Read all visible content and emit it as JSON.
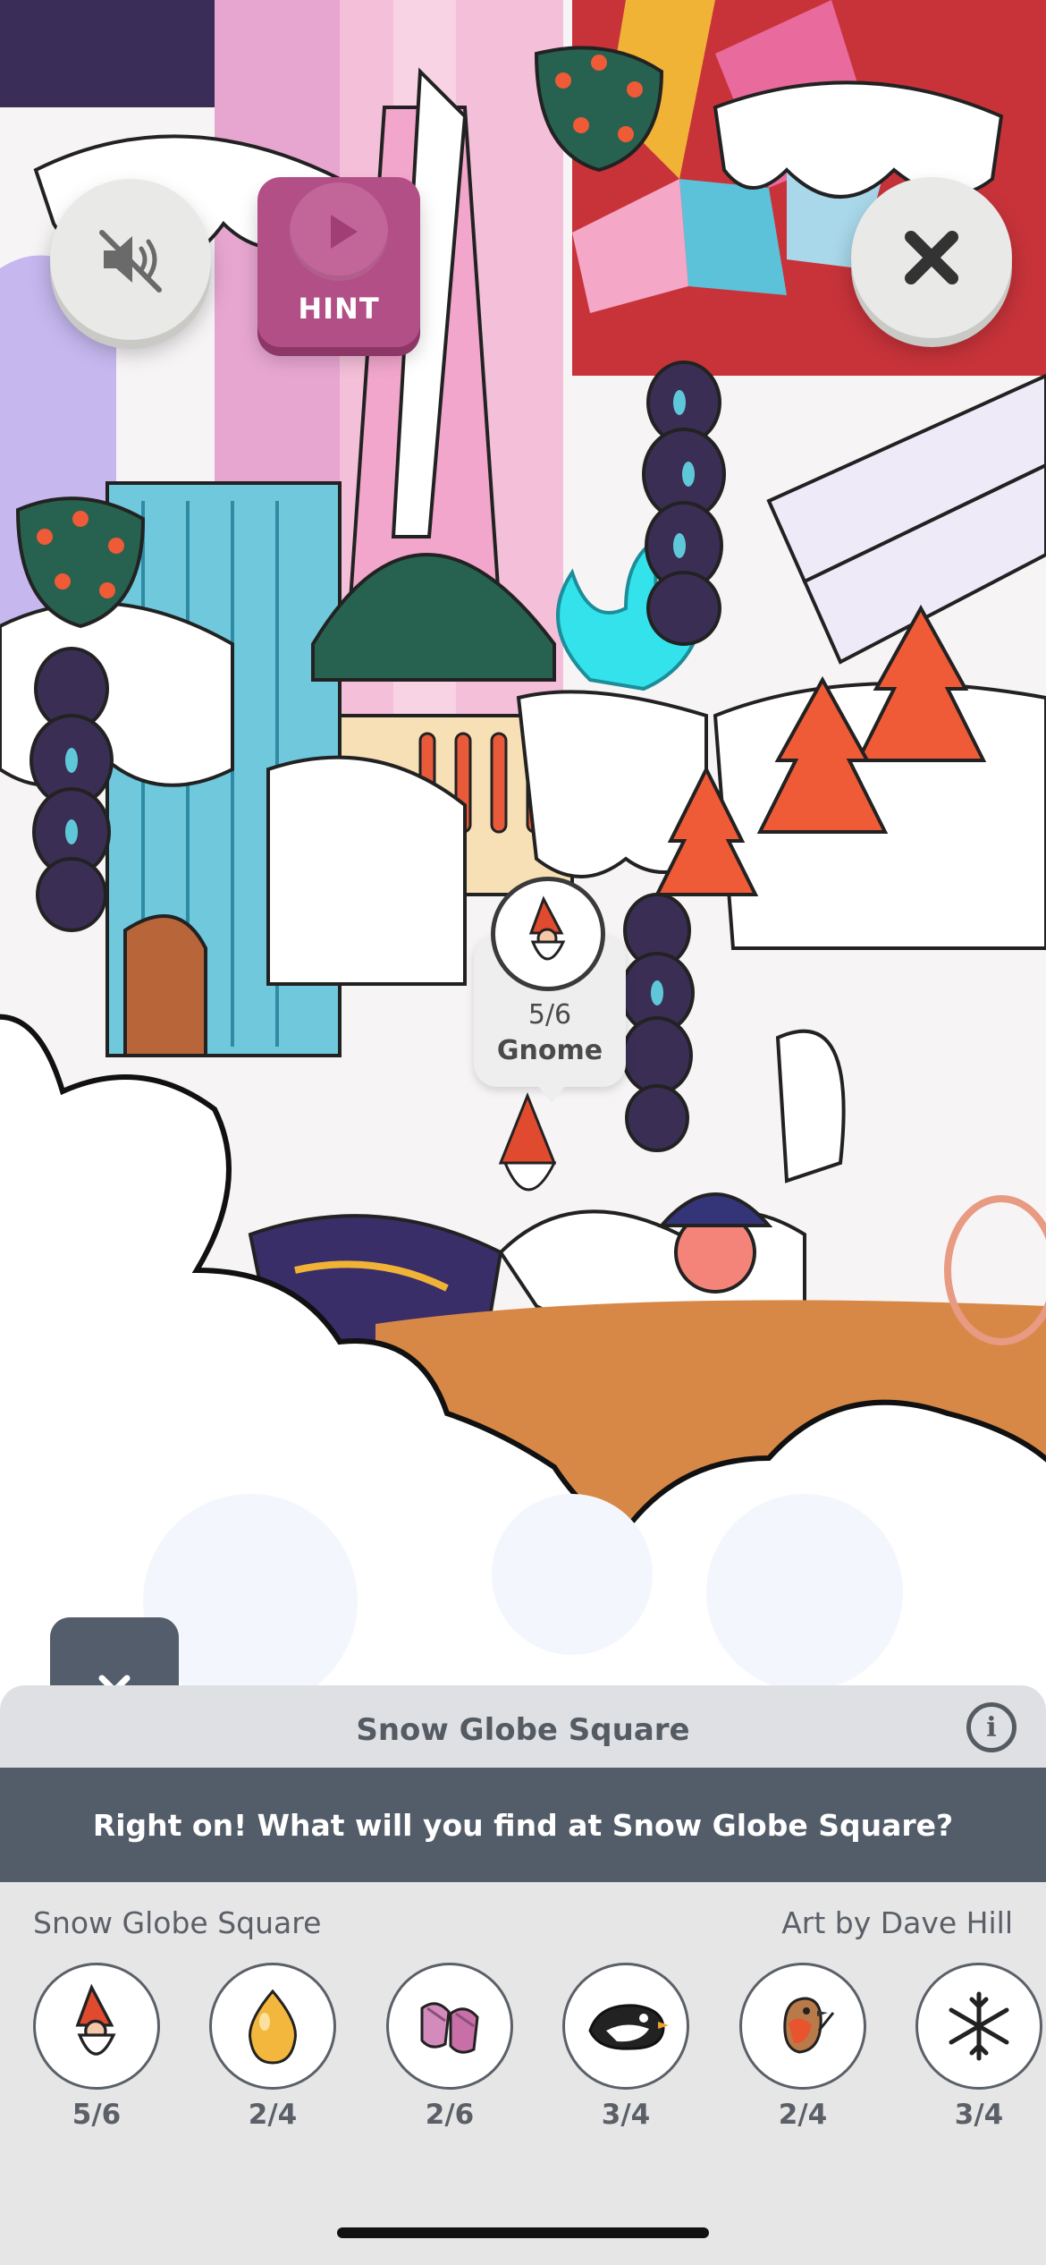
{
  "controls": {
    "mute_icon": "speaker-muted-icon",
    "hint_label": "HINT",
    "close_icon": "close-icon",
    "collapse_icon": "chevron-down-icon"
  },
  "found_tooltip": {
    "item_icon": "gnome-icon",
    "progress": "5/6",
    "name": "Gnome"
  },
  "panel": {
    "title": "Snow Globe Square",
    "info_icon": "info-icon",
    "banner": "Right on! What will you find at Snow Globe Square?",
    "location": "Snow Globe Square",
    "credit": "Art by Dave Hill"
  },
  "items": [
    {
      "icon": "gnome-icon",
      "count": "5/6"
    },
    {
      "icon": "egg-icon",
      "count": "2/4"
    },
    {
      "icon": "mittens-icon",
      "count": "2/6"
    },
    {
      "icon": "penguin-icon",
      "count": "3/4"
    },
    {
      "icon": "robin-icon",
      "count": "2/4"
    },
    {
      "icon": "snowflake-icon",
      "count": "3/4"
    }
  ],
  "colors": {
    "hint": "#b24f86",
    "banner": "#535c69",
    "panel": "#dfe0e3",
    "tray": "#e6e6e6"
  }
}
